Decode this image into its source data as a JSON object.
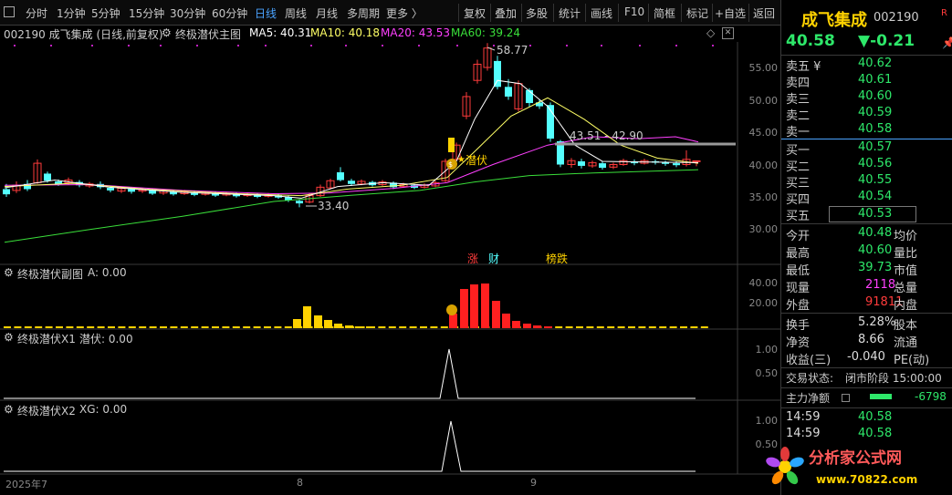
{
  "toolbar": {
    "items": [
      "分时",
      "1分钟",
      "5分钟",
      "15分钟",
      "30分钟",
      "60分钟",
      "日线",
      "周线",
      "月线",
      "多周期",
      "更多 〉"
    ],
    "active": "日线",
    "right_items": [
      "复权",
      "叠加",
      "多股",
      "统计",
      "画线",
      "F10",
      "简框",
      "标记",
      "+自选",
      "返回"
    ]
  },
  "header": {
    "code_name": "002190 成飞集成 (日线,前复权)",
    "indicator_name": "终极潜伏主图",
    "ma5": "MA5: 40.31",
    "ma10": "MA10: 40.18",
    "ma20": "MA20: 43.53",
    "ma60": "MA60: 39.24"
  },
  "main_axis": [
    "55.00",
    "50.00",
    "45.00",
    "40.00",
    "35.00",
    "30.00"
  ],
  "annotations": {
    "high": "58.77",
    "low": "33.40",
    "range": "43.51 - 42.90",
    "signal": "潜伏",
    "tags": [
      "涨",
      "财",
      "榜跌"
    ]
  },
  "sub1": {
    "title": "终极潜伏副图",
    "value": "A: 0.00",
    "axis": [
      "40.00",
      "20.00"
    ]
  },
  "sub2": {
    "title": "终极潜伏X1",
    "value": "潜伏: 0.00",
    "axis": [
      "1.00",
      "0.50"
    ]
  },
  "sub3": {
    "title": "终极潜伏X2",
    "value": "XG: 0.00",
    "axis": [
      "1.00",
      "0.50"
    ]
  },
  "time_axis": [
    "2025年7",
    "8",
    "9"
  ],
  "quote": {
    "name": "成飞集成",
    "code": "002190",
    "r_badge": "R",
    "price": "40.58",
    "change": "▼-0.21",
    "sells": [
      {
        "label": "卖五 ¥",
        "price": "40.62"
      },
      {
        "label": "卖四",
        "price": "40.61"
      },
      {
        "label": "卖三",
        "price": "40.60"
      },
      {
        "label": "卖二",
        "price": "40.59"
      },
      {
        "label": "卖一",
        "price": "40.58"
      }
    ],
    "buys": [
      {
        "label": "买一",
        "price": "40.57"
      },
      {
        "label": "买二",
        "price": "40.56"
      },
      {
        "label": "买三",
        "price": "40.55"
      },
      {
        "label": "买四",
        "price": "40.54"
      },
      {
        "label": "买五",
        "price": "40.53"
      }
    ],
    "stats": [
      {
        "l1": "今开",
        "v1": "40.48",
        "l2": "均价"
      },
      {
        "l1": "最高",
        "v1": "40.60",
        "l2": "量比"
      },
      {
        "l1": "最低",
        "v1": "39.73",
        "l2": "市值"
      },
      {
        "l1": "现量",
        "v1": "2118",
        "l2": "总量"
      },
      {
        "l1": "外盘",
        "v1": "91811",
        "l2": "内盘"
      }
    ],
    "stats2": [
      {
        "l1": "换手",
        "v1": "5.28%",
        "l2": "股本"
      },
      {
        "l1": "净资",
        "v1": "8.66",
        "l2": "流通"
      },
      {
        "l1": "收益(三)",
        "v1": "-0.040",
        "l2": "PE(动)"
      }
    ],
    "trade_status_label": "交易状态:",
    "trade_status": "闭市阶段 15:00:00",
    "main_net_label": "主力净额",
    "main_net": "-6798",
    "ticks": [
      {
        "time": "14:59",
        "price": "40.58"
      },
      {
        "time": "14:59",
        "price": "40.58"
      }
    ]
  },
  "watermark": {
    "text": "分析家公式网",
    "url": "www.70822.com"
  },
  "colors": {
    "up": "#ff3b3b",
    "down": "#54ffff",
    "ma5": "#ffffff",
    "ma10": "#ffff66",
    "ma20": "#ff40ff",
    "ma60": "#3adf3a",
    "accent": "#4aa3ff"
  }
}
